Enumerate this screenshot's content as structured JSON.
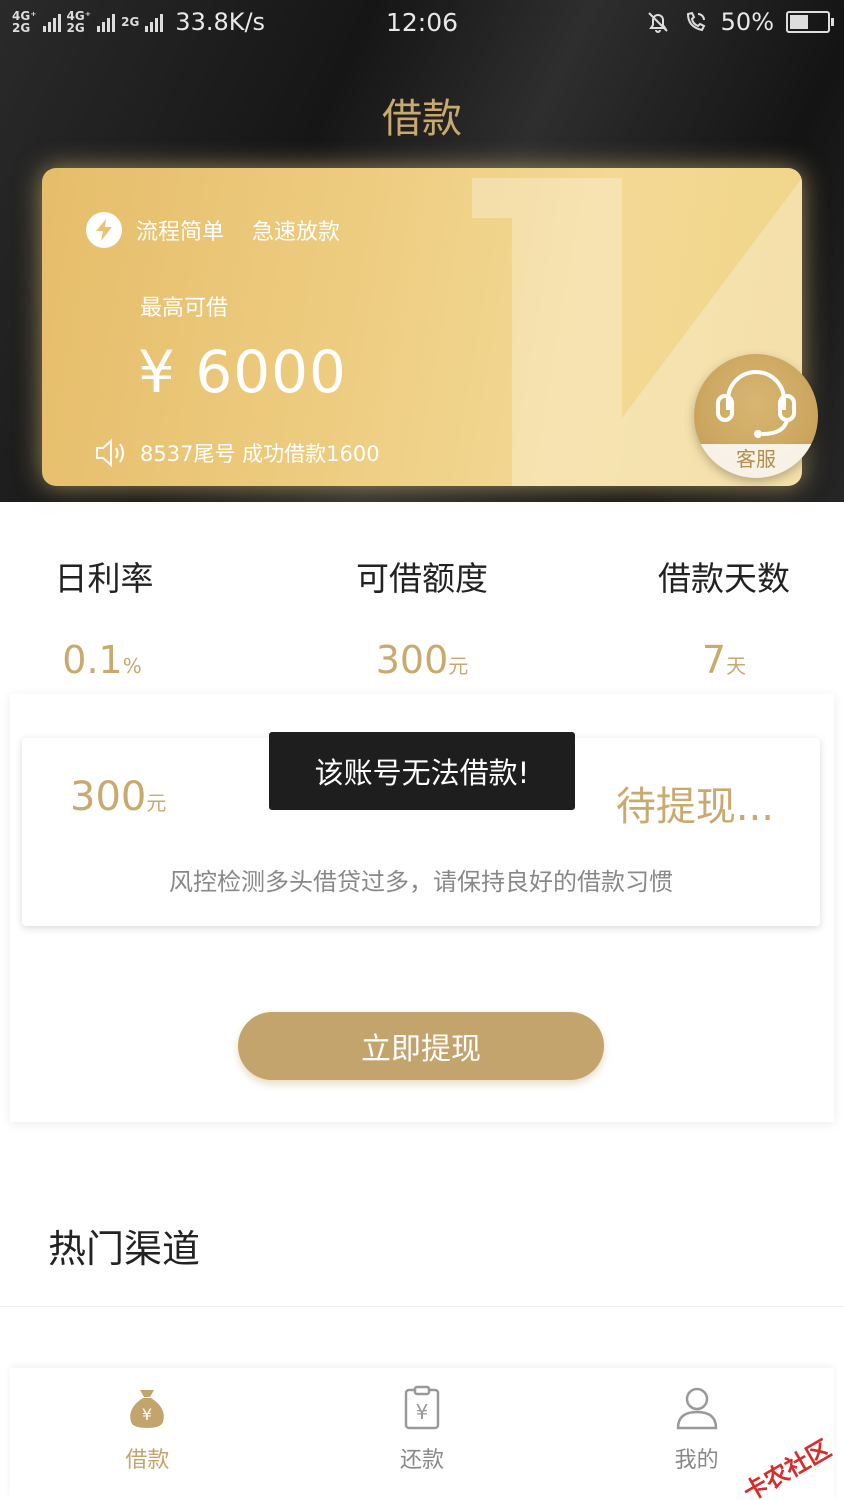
{
  "status_bar": {
    "net1": "4G⁺\n2G",
    "net2": "4G⁺\n2G",
    "net3": "2G",
    "speed": "33.8K/s",
    "time": "12:06",
    "battery": "50%",
    "battery_level": 0.5
  },
  "header": {
    "title": "借款"
  },
  "card": {
    "tag1": "流程简单",
    "tag2": "急速放款",
    "label": "最高可借",
    "amount": "¥ 6000",
    "notice": "8537尾号 成功借款1600",
    "service_label": "客服"
  },
  "stats": [
    {
      "label": "日利率",
      "value": "0.1",
      "unit": "%"
    },
    {
      "label": "可借额度",
      "value": "300",
      "unit": "元"
    },
    {
      "label": "借款天数",
      "value": "7",
      "unit": "天"
    }
  ],
  "loan_card": {
    "amount": "300",
    "unit": "元",
    "status": "待提现...",
    "note": "风控检测多头借贷过多，请保持良好的借款习惯"
  },
  "toast": "该账号无法借款!",
  "cta": "立即提现",
  "section_title": "热门渠道",
  "tabs": [
    {
      "label": "借款",
      "icon": "money-bag-icon"
    },
    {
      "label": "还款",
      "icon": "repay-icon"
    },
    {
      "label": "我的",
      "icon": "user-icon"
    }
  ],
  "watermark": "卡农社区",
  "colors": {
    "gold": "#c8a96e",
    "dark": "#1a1a1a"
  }
}
